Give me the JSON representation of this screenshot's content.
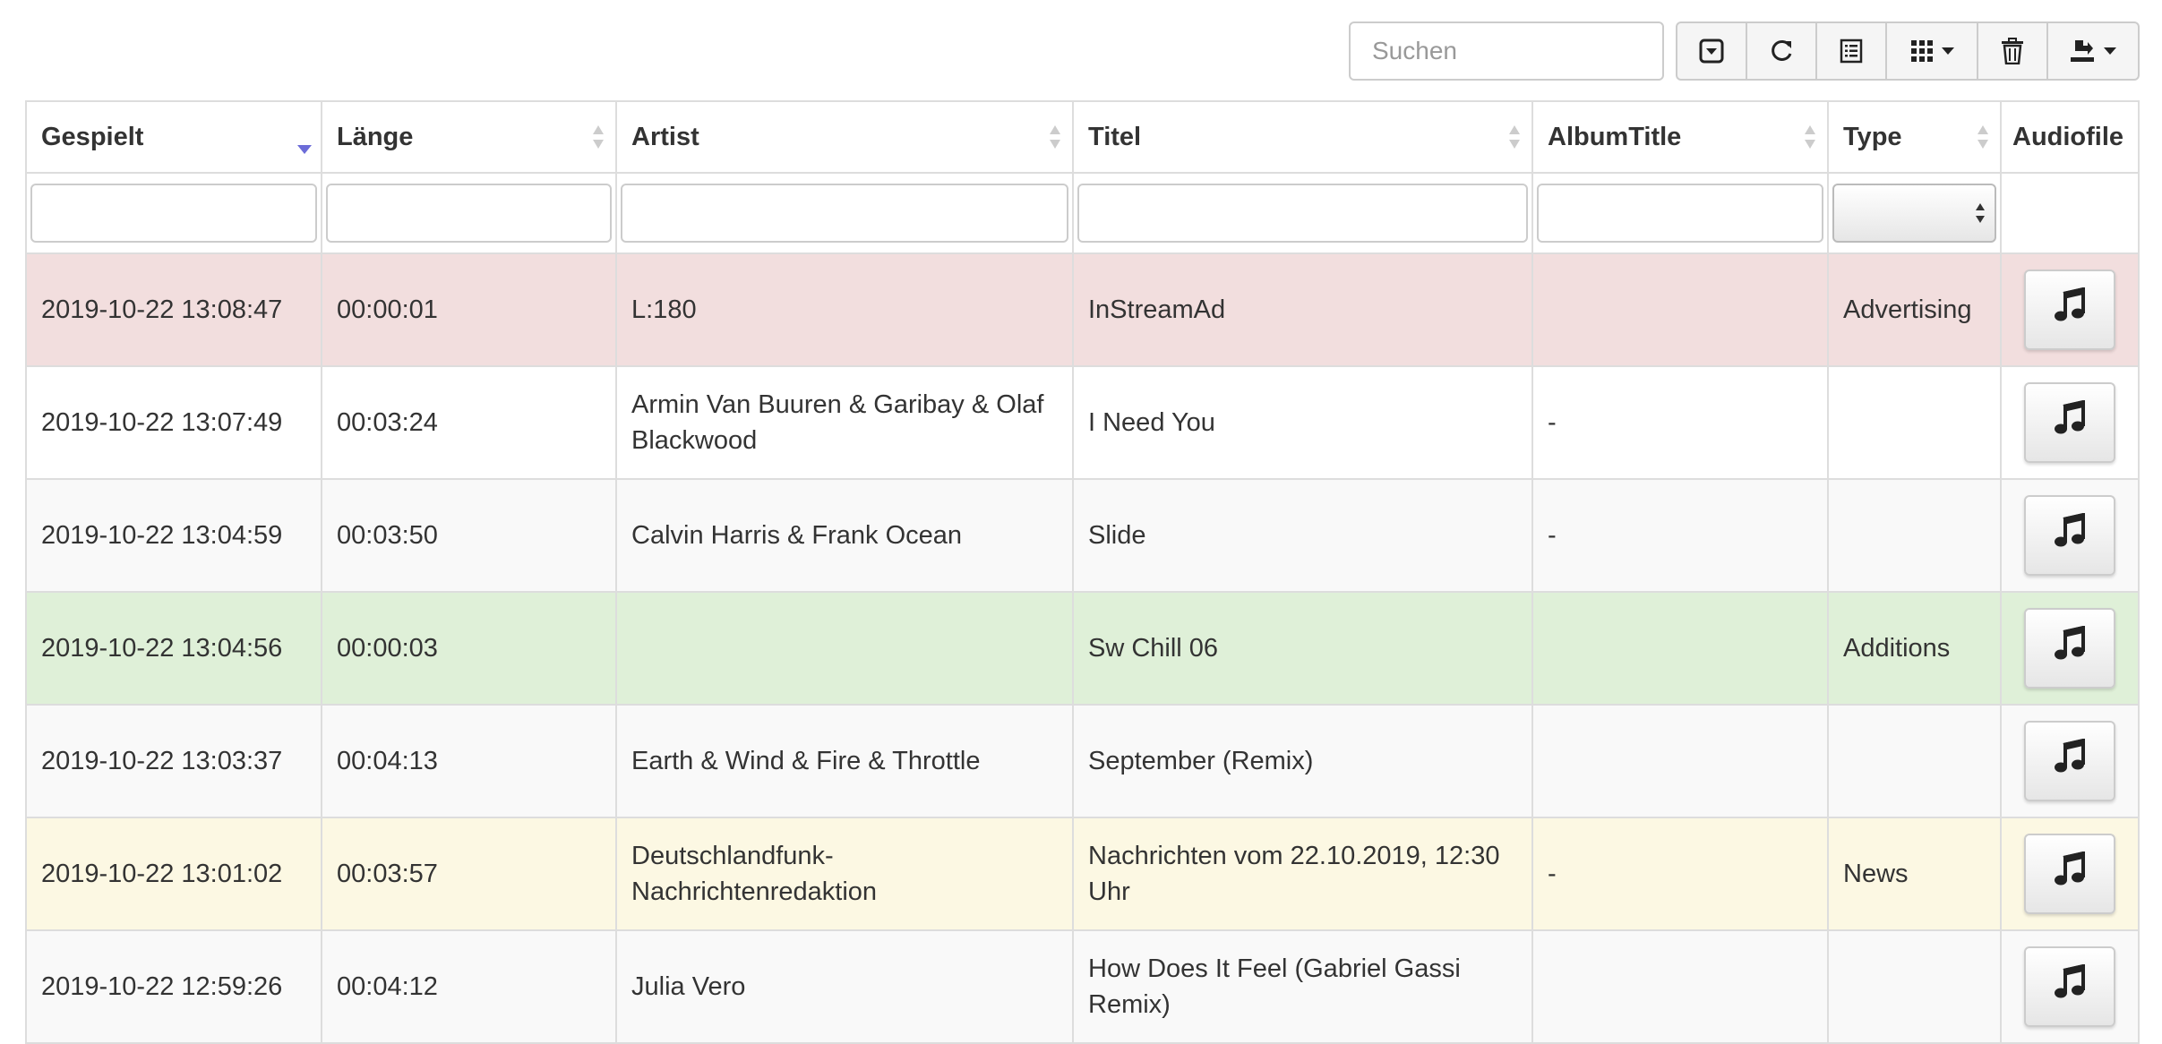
{
  "search": {
    "placeholder": "Suchen",
    "value": ""
  },
  "toolbar": {
    "buttons": [
      {
        "name": "toggle-pagination-button",
        "icon": "collapse-down-icon"
      },
      {
        "name": "refresh-button",
        "icon": "refresh-icon"
      },
      {
        "name": "toggle-view-button",
        "icon": "list-alt-icon"
      },
      {
        "name": "columns-button",
        "icon": "grid-icon",
        "dropdown": true
      },
      {
        "name": "delete-button",
        "icon": "trash-icon"
      },
      {
        "name": "export-button",
        "icon": "export-icon",
        "dropdown": true
      }
    ]
  },
  "table": {
    "columns": [
      {
        "label": "Gespielt",
        "sort": "desc"
      },
      {
        "label": "Länge",
        "sort": "both"
      },
      {
        "label": "Artist",
        "sort": "both"
      },
      {
        "label": "Titel",
        "sort": "both"
      },
      {
        "label": "AlbumTitle",
        "sort": "both"
      },
      {
        "label": "Type",
        "sort": "both"
      },
      {
        "label": "Audiofile",
        "sort": "none"
      }
    ],
    "rows": [
      {
        "state": "danger",
        "played": "2019-10-22 13:08:47",
        "length": "00:00:01",
        "artist": "L:180",
        "title": "InStreamAd",
        "album": "",
        "type": "Advertising",
        "audio_icon": "music-note-icon"
      },
      {
        "state": "white",
        "played": "2019-10-22 13:07:49",
        "length": "00:03:24",
        "artist": "Armin Van Buuren & Garibay & Olaf Blackwood",
        "title": "I Need You",
        "album": "-",
        "type": "",
        "audio_icon": "music-note-icon"
      },
      {
        "state": "grey",
        "played": "2019-10-22 13:04:59",
        "length": "00:03:50",
        "artist": "Calvin Harris & Frank Ocean",
        "title": "Slide",
        "album": "-",
        "type": "",
        "audio_icon": "music-note-icon"
      },
      {
        "state": "success",
        "played": "2019-10-22 13:04:56",
        "length": "00:00:03",
        "artist": "",
        "title": "Sw Chill 06",
        "album": "",
        "type": "Additions",
        "audio_icon": "music-note-icon"
      },
      {
        "state": "grey",
        "played": "2019-10-22 13:03:37",
        "length": "00:04:13",
        "artist": "Earth & Wind & Fire & Throttle",
        "title": "September (Remix)",
        "album": "",
        "type": "",
        "audio_icon": "music-note-icon"
      },
      {
        "state": "warning",
        "played": "2019-10-22 13:01:02",
        "length": "00:03:57",
        "artist": "Deutschlandfunk-Nachrichtenredaktion",
        "title": "Nachrichten vom 22.10.2019, 12:30 Uhr",
        "album": "-",
        "type": "News",
        "audio_icon": "music-note-icon"
      },
      {
        "state": "grey",
        "played": "2019-10-22 12:59:26",
        "length": "00:04:12",
        "artist": "Julia Vero",
        "title": "How Does It Feel (Gabriel Gassi Remix)",
        "album": "",
        "type": "",
        "audio_icon": "music-note-icon"
      }
    ]
  },
  "colors": {
    "danger_row": "#f2dede",
    "success_row": "#dff0d8",
    "warning_row": "#fcf8e3",
    "striped_row": "#f9f9f9",
    "sort_active": "#6c6cd8",
    "sort_inactive": "#cccccc"
  }
}
